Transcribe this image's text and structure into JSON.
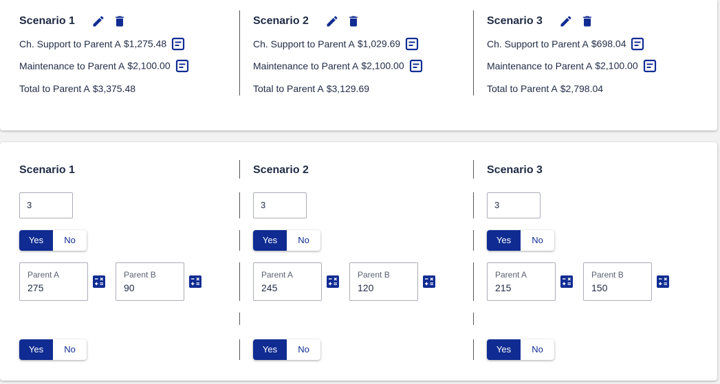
{
  "colors": {
    "accent": "#102c92",
    "text": "#1f2a44"
  },
  "summary": [
    {
      "title": "Scenario 1",
      "support_label": "Ch. Support to Parent A",
      "support_value": "$1,275.48",
      "maintenance_label": "Maintenance to Parent A",
      "maintenance_value": "$2,100.00",
      "total_label": "Total to Parent A",
      "total_value": "$3,375.48"
    },
    {
      "title": "Scenario 2",
      "support_label": "Ch. Support to Parent A",
      "support_value": "$1,029.69",
      "maintenance_label": "Maintenance to Parent A",
      "maintenance_value": "$2,100.00",
      "total_label": "Total to Parent A",
      "total_value": "$3,129.69"
    },
    {
      "title": "Scenario 3",
      "support_label": "Ch. Support to Parent A",
      "support_value": "$698.04",
      "maintenance_label": "Maintenance to Parent A",
      "maintenance_value": "$2,100.00",
      "total_label": "Total to Parent A",
      "total_value": "$2,798.04"
    }
  ],
  "inputs": [
    {
      "title": "Scenario 1",
      "count": "3",
      "toggle1": {
        "yes": "Yes",
        "no": "No",
        "selected": "Yes"
      },
      "parent_a_label": "Parent A",
      "parent_a_value": "275",
      "parent_b_label": "Parent B",
      "parent_b_value": "90",
      "toggle2": {
        "yes": "Yes",
        "no": "No",
        "selected": "Yes"
      }
    },
    {
      "title": "Scenario 2",
      "count": "3",
      "toggle1": {
        "yes": "Yes",
        "no": "No",
        "selected": "Yes"
      },
      "parent_a_label": "Parent A",
      "parent_a_value": "245",
      "parent_b_label": "Parent B",
      "parent_b_value": "120",
      "toggle2": {
        "yes": "Yes",
        "no": "No",
        "selected": "Yes"
      }
    },
    {
      "title": "Scenario 3",
      "count": "3",
      "toggle1": {
        "yes": "Yes",
        "no": "No",
        "selected": "Yes"
      },
      "parent_a_label": "Parent A",
      "parent_a_value": "215",
      "parent_b_label": "Parent B",
      "parent_b_value": "150",
      "toggle2": {
        "yes": "Yes",
        "no": "No",
        "selected": "Yes"
      }
    }
  ]
}
